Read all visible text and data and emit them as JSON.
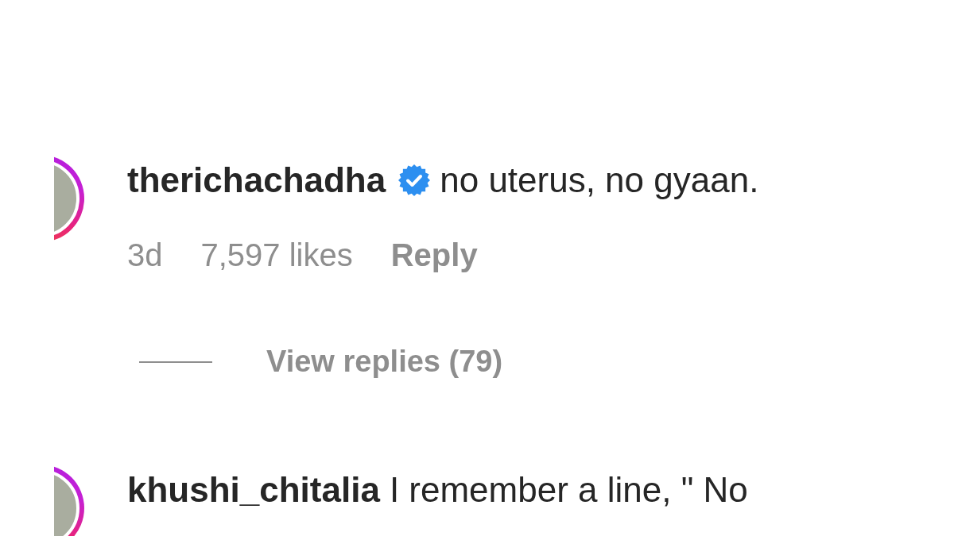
{
  "comments": [
    {
      "username": "therichachadha",
      "verified": true,
      "text": "no uterus, no gyaan.",
      "time": "3d",
      "likes": "7,597 likes",
      "reply_label": "Reply",
      "view_replies": "View replies (79)"
    },
    {
      "username": "khushi_chitalia",
      "verified": false,
      "text": "I remember a line, \" No"
    }
  ]
}
